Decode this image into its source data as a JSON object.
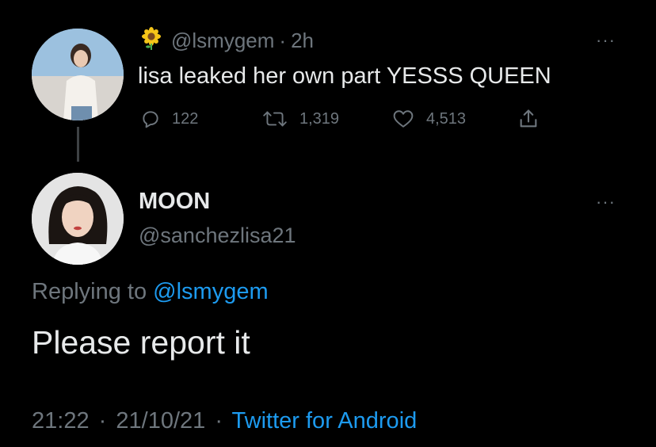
{
  "tweet": {
    "emoji": "🌻",
    "handle": "@lsmygem",
    "separator": "·",
    "time": "2h",
    "text": "lisa leaked her own part YESSS QUEEN",
    "more": "···",
    "replies": "122",
    "retweets": "1,319",
    "likes": "4,513"
  },
  "reply": {
    "name": "MOON",
    "handle": "@sanchezlisa21",
    "more": "···",
    "replying_prefix": "Replying to",
    "replying_to": "@lsmygem",
    "text": "Please report it",
    "time": "21:22",
    "dot1": "·",
    "date": "21/10/21",
    "dot2": "·",
    "source": "Twitter for Android"
  },
  "colors": {
    "background": "#000000",
    "text": "#e7e9ea",
    "muted": "#6e767d",
    "link": "#1d9bf0"
  }
}
